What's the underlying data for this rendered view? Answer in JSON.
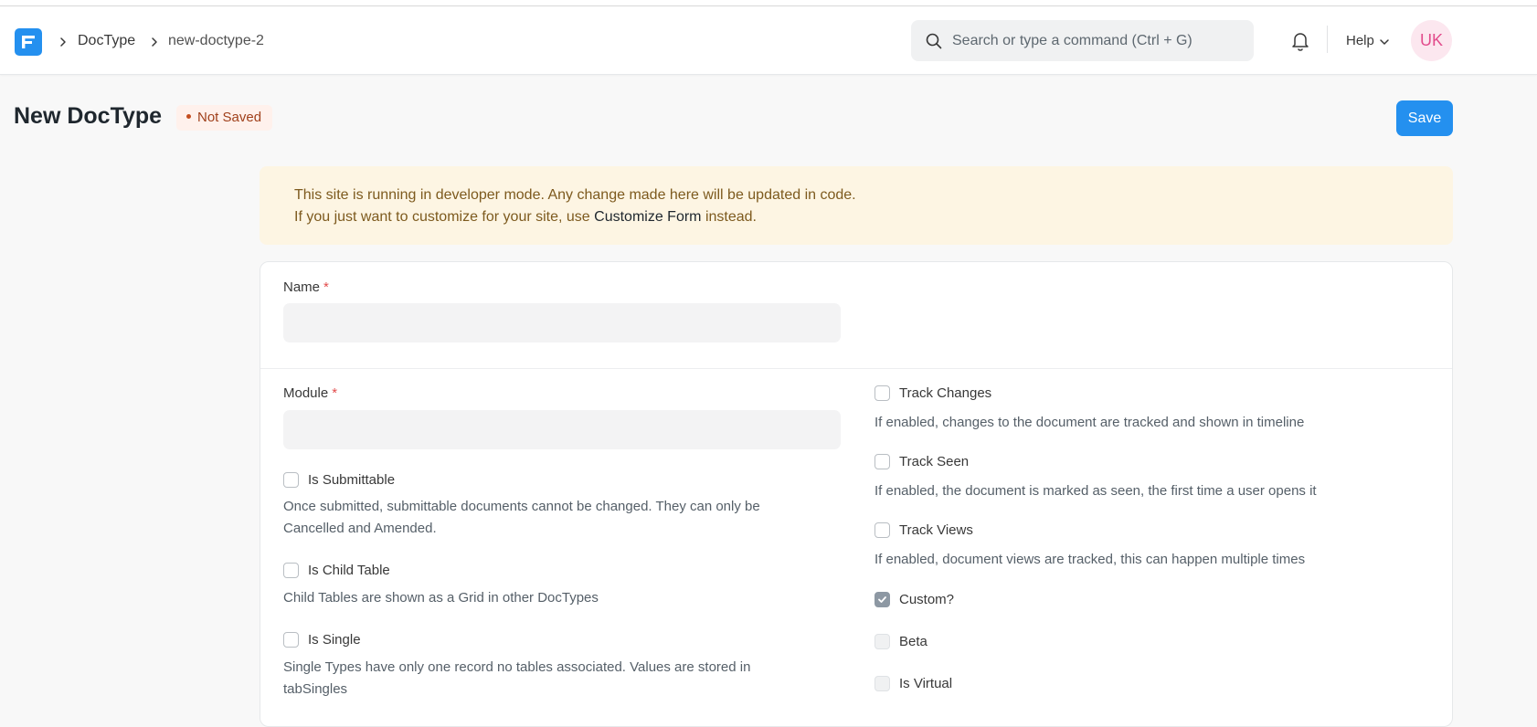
{
  "breadcrumbs": [
    "DocType",
    "new-doctype-2"
  ],
  "search": {
    "placeholder": "Search or type a command (Ctrl + G)"
  },
  "navbar": {
    "help_label": "Help",
    "avatar_initials": "UK"
  },
  "page": {
    "title": "New DocType",
    "status_badge": "Not Saved",
    "save_label": "Save"
  },
  "alert": {
    "line1": "This site is running in developer mode. Any change made here will be updated in code.",
    "line2_prefix": "If you just want to customize for your site, use ",
    "line2_link": "Customize Form",
    "line2_suffix": " instead."
  },
  "form": {
    "name_label": "Name",
    "name_value": "",
    "module_label": "Module",
    "module_value": "",
    "left_checks": [
      {
        "label": "Is Submittable",
        "checked": false,
        "description_1": "Once submitted, submittable documents cannot be changed. They can only be",
        "description_2": "Cancelled and Amended."
      },
      {
        "label": "Is Child Table",
        "checked": false,
        "description_1": "Child Tables are shown as a Grid in other DocTypes"
      },
      {
        "label": "Is Single",
        "checked": false,
        "description_1": "Single Types have only one record no tables associated. Values are stored in",
        "description_2": "tabSingles"
      }
    ],
    "right_checks": [
      {
        "label": "Track Changes",
        "checked": false,
        "description": "If enabled, changes to the document are tracked and shown in timeline"
      },
      {
        "label": "Track Seen",
        "checked": false,
        "description": "If enabled, the document is marked as seen, the first time a user opens it"
      },
      {
        "label": "Track Views",
        "checked": false,
        "description": "If enabled, document views are tracked, this can happen multiple times"
      },
      {
        "label": "Custom?",
        "checked": true
      },
      {
        "label": "Beta",
        "checked": false,
        "disabled": true
      },
      {
        "label": "Is Virtual",
        "checked": false,
        "disabled": true
      }
    ]
  },
  "colors": {
    "accent": "#2490ef",
    "alert_bg": "#fdf5e3",
    "badge_bg": "#fff1ec",
    "required": "#e24c4c"
  },
  "icons": [
    "frappe-logo-icon",
    "chevron-right-icon",
    "search-icon",
    "bell-icon",
    "chevron-down-icon",
    "checkmark-icon"
  ]
}
